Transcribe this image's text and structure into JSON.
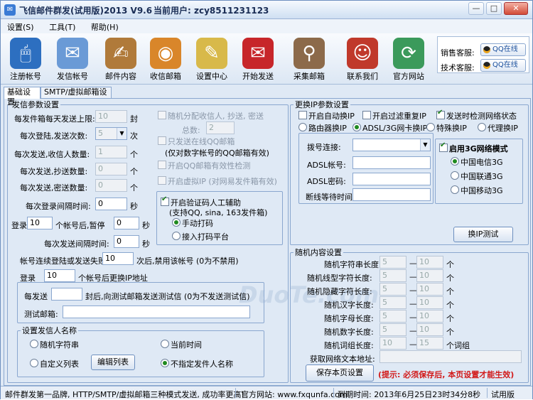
{
  "window": {
    "title": "飞信邮件群发(试用版)2013 V9.6",
    "current_user": "当前用户: zcy8511231123"
  },
  "menu": [
    "设置(S)",
    "工具(T)",
    "帮助(H)"
  ],
  "toolbar": [
    {
      "label": "注册帐号",
      "icon": "mouse-icon",
      "color": "#2d6fc0"
    },
    {
      "label": "发信帐号",
      "icon": "envelope-icon",
      "color": "#6a9ad6"
    },
    {
      "label": "邮件内容",
      "icon": "document-icon",
      "color": "#b07a3a"
    },
    {
      "label": "收信邮箱",
      "icon": "globe-mailbox-icon",
      "color": "#d9862a"
    },
    {
      "label": "设置中心",
      "icon": "pen-icon",
      "color": "#d8b94a"
    },
    {
      "label": "开始发送",
      "icon": "post-box-icon",
      "color": "#c7262a"
    },
    {
      "label": "采集邮箱",
      "icon": "address-book-icon",
      "color": "#8c6a4a"
    },
    {
      "label": "联系我们",
      "icon": "people-icon",
      "color": "#c0392b"
    },
    {
      "label": "官方网站",
      "icon": "website-icon",
      "color": "#3b9a5b"
    }
  ],
  "service": {
    "sales_label": "销售客服:",
    "tech_label": "技术客服:",
    "qq_label": "QQ在线"
  },
  "tabs": [
    "基础设置",
    "SMTP/虚拟邮箱设置"
  ],
  "send_params": {
    "legend": "发信参数设置",
    "daily_limit_label": "每发件箱每天发送上限:",
    "daily_limit_value": "10",
    "daily_limit_unit": "封",
    "send_times_label": "每次登陆,发送次数:",
    "send_times_value": "5",
    "send_times_unit": "次",
    "recipients_label": "每次发送,收信人数量:",
    "recipients_value": "1",
    "recipients_unit": "个",
    "cc_label": "每次发送,抄送数量:",
    "cc_value": "0",
    "cc_unit": "个",
    "bcc_label": "每次发送,密送数量:",
    "bcc_value": "0",
    "bcc_unit": "个",
    "login_interval_label": "每次登录间隔时间:",
    "login_interval_value": "0",
    "login_interval_unit": "秒",
    "pause_prefix": "登录",
    "pause_count": "10",
    "pause_middle": "个帐号后,暂停",
    "pause_value": "0",
    "pause_unit": "秒",
    "send_interval_label": "每次发送间隔时间:",
    "send_interval_value": "0",
    "send_interval_unit": "秒",
    "fail_label": "帐号连续登陆或发送失败",
    "fail_value": "10",
    "fail_suffix": "次后,禁用该帐号 (0为不禁用)",
    "ip_prefix": "登录",
    "ip_value": "10",
    "ip_suffix": "个帐号后更换IP地址",
    "random_recipients": "随机分配收信人, 抄送, 密送",
    "total_label": "总数:",
    "total_value": "2",
    "only_qq": "只发送在线QQ邮箱",
    "only_qq_note": "(仅对数字帐号的QQ邮箱有效)",
    "qq_valid": "开启QQ邮箱有效性检测",
    "virtual_ip": "开启虚拟IP (对网易发件箱有效)",
    "captcha": "开启验证码人工辅助",
    "captcha_note": "(支持QQ, sina, 163发件箱)",
    "captcha_manual": "手动打码",
    "captcha_platform": "接入打码平台"
  },
  "test_mail": {
    "prefix": "每发送",
    "value": "",
    "suffix": "封后,向测试邮箱发送测试信 (0为不发送测试信)",
    "addr_label": "测试邮箱:",
    "addr_value": ""
  },
  "sender_name": {
    "legend": "设置发信人名称",
    "random": "随机字符串",
    "current_time": "当前时间",
    "custom_list": "自定义列表",
    "edit_list": "编辑列表",
    "unspecified": "不指定发件人名称"
  },
  "ip_params": {
    "legend": "更换IP参数设置",
    "auto_ip": "开启自动换IP",
    "filter_dup": "开启过滤重复IP",
    "check_net": "发送时检测网络状态",
    "router": "路由器换IP",
    "adsl": "ADSL/3G网卡换IP",
    "special": "特殊换IP",
    "proxy": "代理换IP",
    "dial_label": "拨号连接:",
    "adsl_account_label": "ADSL帐号:",
    "adsl_pwd_label": "ADSL密码:",
    "wait_label": "断线等待时间 (秒):",
    "mode3g": "启用3G网络模式",
    "telecom": "中国电信3G",
    "unicom": "中国联通3G",
    "mobile": "中国移动3G",
    "test_button": "换IP测试"
  },
  "random_content": {
    "legend": "随机内容设置",
    "rows": [
      {
        "label": "随机字符串长度:",
        "min": "5",
        "max": "10",
        "unit": "个"
      },
      {
        "label": "随机线型字符长度:",
        "min": "5",
        "max": "10",
        "unit": "个"
      },
      {
        "label": "随机隐藏字符长度:",
        "min": "5",
        "max": "10",
        "unit": "个"
      },
      {
        "label": "随机汉字长度:",
        "min": "5",
        "max": "10",
        "unit": "个"
      },
      {
        "label": "随机字母长度:",
        "min": "5",
        "max": "10",
        "unit": "个"
      },
      {
        "label": "随机数字长度:",
        "min": "5",
        "max": "10",
        "unit": "个"
      },
      {
        "label": "随机词组长度:",
        "min": "10",
        "max": "15",
        "unit": "个词组"
      }
    ],
    "dash": "—",
    "fetch_label": "获取网络文本地址:",
    "fetch_value": ""
  },
  "save_button": "保存本页设置",
  "hint": "(提示: 必须保存后, 本页设置才能生效)",
  "status": {
    "left": "邮件群发第一品牌, HTTP/SMTP/虚拟邮箱三种模式发送, 成功率更高!",
    "site": "官方网站: www.fxqunfa.com",
    "expire": "到期时间: 2013年6月25日23时34分8秒",
    "version": "试用版"
  }
}
